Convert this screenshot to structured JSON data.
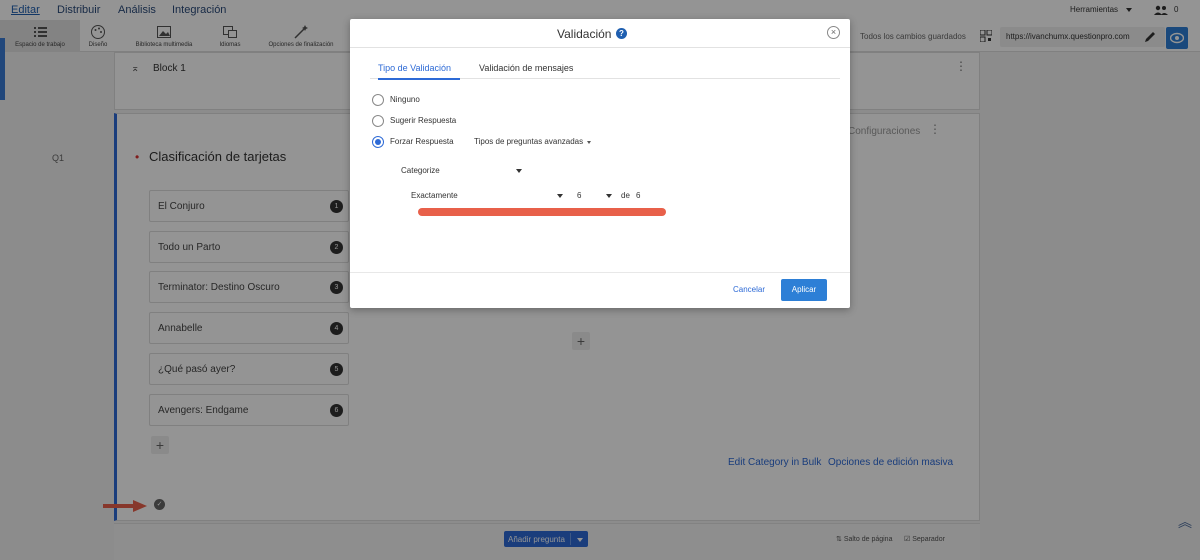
{
  "menu": {
    "items": [
      "Editar",
      "Distribuir",
      "Análisis",
      "Integración"
    ],
    "tools_label": "Herramientas",
    "users_count": "0"
  },
  "toolbar": {
    "items": [
      {
        "label": "Espacio de trabajo",
        "icon": "list-icon"
      },
      {
        "label": "Diseño",
        "icon": "palette-icon"
      },
      {
        "label": "Biblioteca multimedia",
        "icon": "image-icon"
      },
      {
        "label": "Idiomas",
        "icon": "language-icon"
      },
      {
        "label": "Opciones de finalización",
        "icon": "wand-icon"
      }
    ],
    "saved_status": "Todos los cambios guardados",
    "url": "https://ivanchumx.questionpro.com"
  },
  "survey": {
    "block_title": "Block 1",
    "question_number": "Q1",
    "question_title": "Clasificación de tarjetas",
    "config_label": "Configuraciones",
    "cards": [
      {
        "text": "El Conjuro",
        "num": "1"
      },
      {
        "text": "Todo un Parto",
        "num": "2"
      },
      {
        "text": "Terminator: Destino Oscuro",
        "num": "3"
      },
      {
        "text": "Annabelle",
        "num": "4"
      },
      {
        "text": "¿Qué pasó ayer?",
        "num": "5"
      },
      {
        "text": "Avengers: Endgame",
        "num": "6"
      }
    ],
    "edit_bulk": "Edit Category in Bulk",
    "bulk_options": "Opciones de edición masiva",
    "add_question": "Añadir pregunta",
    "page_break": "Salto de página",
    "separator": "Separador"
  },
  "modal": {
    "title": "Validación",
    "tabs": [
      "Tipo de Validación",
      "Validación de mensajes"
    ],
    "options": [
      "Ninguno",
      "Sugerir Respuesta",
      "Forzar Respuesta"
    ],
    "selected_option": "Forzar Respuesta",
    "advanced_label": "Tipos de preguntas avanzadas",
    "category_label": "Categorize",
    "exact_label": "Exactamente",
    "count_value": "6",
    "of_label": "de",
    "total_value": "6",
    "cancel_label": "Cancelar",
    "apply_label": "Aplicar"
  },
  "colors": {
    "accent": "#2d6ad6",
    "highlight": "#e8604a"
  }
}
